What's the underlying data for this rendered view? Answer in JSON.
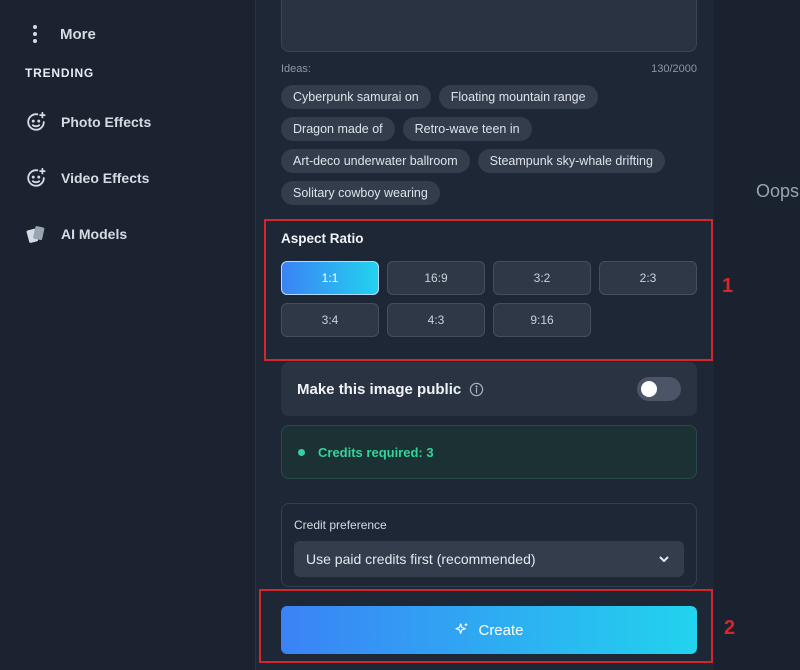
{
  "sidebar": {
    "more_label": "More",
    "trending_heading": "TRENDING",
    "items": [
      {
        "label": "Photo Effects",
        "icon": "face-plus-icon"
      },
      {
        "label": "Video Effects",
        "icon": "face-plus-icon"
      },
      {
        "label": "AI Models",
        "icon": "cards-icon"
      }
    ]
  },
  "prompt": {
    "ideas_label": "Ideas:",
    "char_count": "130/2000",
    "ideas": [
      "Cyberpunk samurai on",
      "Floating mountain range",
      "Dragon made of",
      "Retro-wave teen in",
      "Art-deco underwater ballroom",
      "Steampunk sky-whale drifting",
      "Solitary cowboy wearing"
    ]
  },
  "aspect_ratio": {
    "title": "Aspect Ratio",
    "options": [
      "1:1",
      "16:9",
      "3:2",
      "2:3",
      "3:4",
      "4:3",
      "9:16"
    ],
    "selected": "1:1"
  },
  "public_toggle": {
    "label": "Make this image public",
    "enabled": false
  },
  "credits": {
    "text": "Credits required: 3"
  },
  "credit_preference": {
    "label": "Credit preference",
    "selected": "Use paid credits first (recommended)"
  },
  "create_button": {
    "label": "Create"
  },
  "annotations": {
    "box1": "1",
    "box2": "2"
  },
  "right_pane": {
    "partial_text": "Oops"
  },
  "colors": {
    "accent_start": "#3b82f6",
    "accent_end": "#22d3ee",
    "credits_green": "#34d399",
    "annotation_red": "#d7262b"
  }
}
